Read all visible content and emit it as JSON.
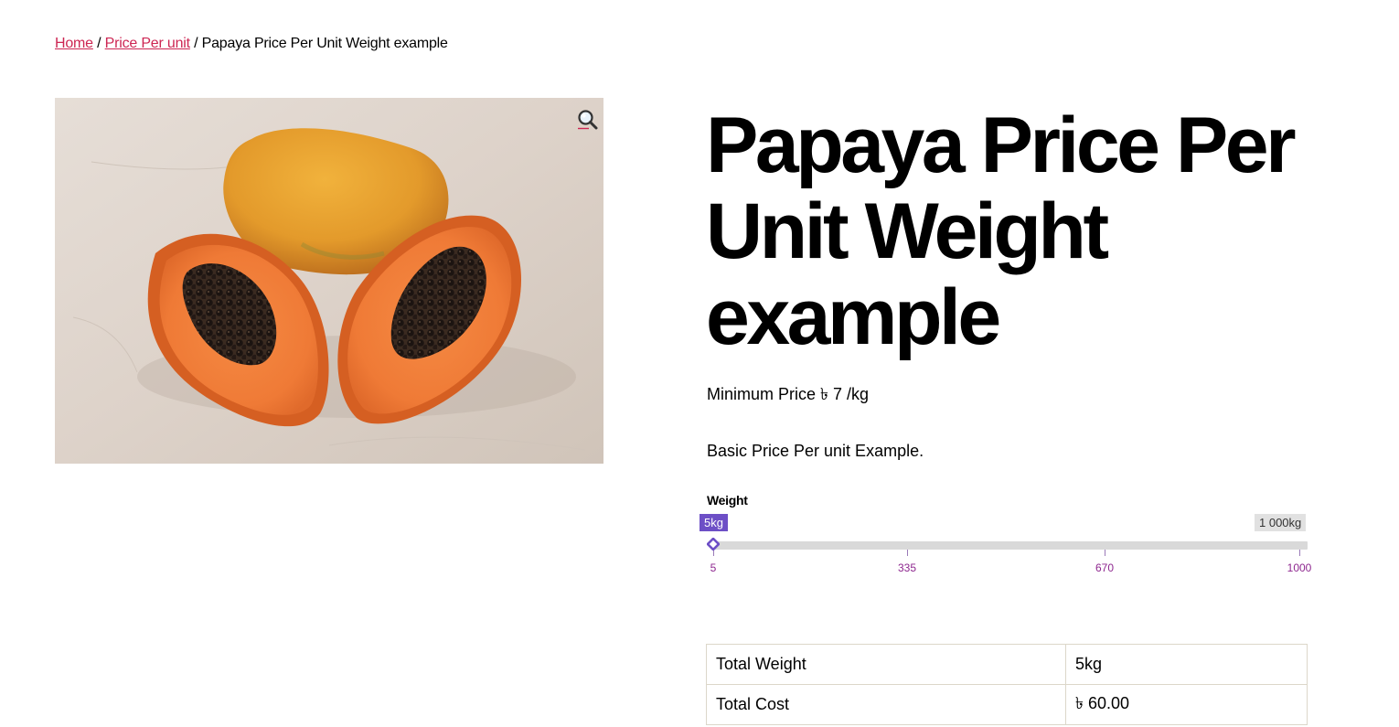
{
  "breadcrumb": {
    "home": "Home",
    "separator_1": "/",
    "category": "Price Per unit",
    "separator_2": "/",
    "current": "Papaya Price Per Unit Weight example"
  },
  "product": {
    "title": "Papaya Price Per Unit Weight example",
    "image_alt": "Papaya fruit",
    "min_price": "Minimum Price ৳ 7 /kg",
    "description": "Basic Price Per unit Example."
  },
  "weight_slider": {
    "label": "Weight",
    "current_label": "5kg",
    "max_label": "1 000kg",
    "min": 5,
    "max": 1000,
    "value": 5,
    "ticks": [
      "5",
      "335",
      "670",
      "1000"
    ]
  },
  "summary": {
    "rows": [
      {
        "label": "Total Weight",
        "value": "5kg"
      },
      {
        "label": "Total Cost",
        "value": "৳ 60.00"
      }
    ]
  },
  "colors": {
    "link": "#cd2653",
    "slider_accent": "#6d4fc6",
    "tick_label": "#8e278f"
  },
  "icons": {
    "zoom": "magnifier-icon"
  }
}
